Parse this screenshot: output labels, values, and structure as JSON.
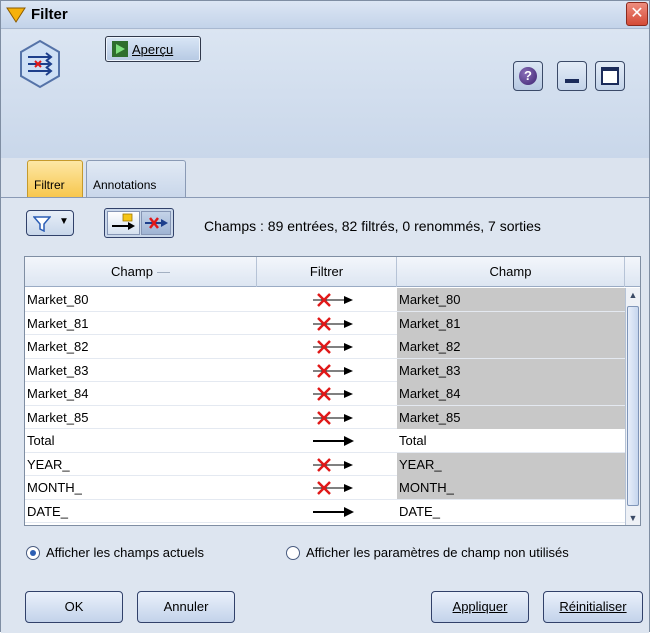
{
  "window": {
    "title": "Filter",
    "close_symbol": "✕"
  },
  "toolbar": {
    "preview_label": "Aperçu",
    "help_symbol": "?"
  },
  "tabs": [
    {
      "label": "Filtrer",
      "active": true
    },
    {
      "label": "Annotations",
      "active": false
    }
  ],
  "filter_bar": {
    "summary": "Champs : 89 entrées, 82 filtrés, 0 renommés, 7 sorties"
  },
  "grid": {
    "headers": [
      "Champ",
      "Filtrer",
      "Champ"
    ],
    "rows": [
      {
        "in": "Market_80",
        "out": "Market_80",
        "filtered": true
      },
      {
        "in": "Market_81",
        "out": "Market_81",
        "filtered": true
      },
      {
        "in": "Market_82",
        "out": "Market_82",
        "filtered": true
      },
      {
        "in": "Market_83",
        "out": "Market_83",
        "filtered": true
      },
      {
        "in": "Market_84",
        "out": "Market_84",
        "filtered": true
      },
      {
        "in": "Market_85",
        "out": "Market_85",
        "filtered": true
      },
      {
        "in": "Total",
        "out": "Total",
        "filtered": false
      },
      {
        "in": "YEAR_",
        "out": "YEAR_",
        "filtered": true
      },
      {
        "in": "MONTH_",
        "out": "MONTH_",
        "filtered": true
      },
      {
        "in": "DATE_",
        "out": "DATE_",
        "filtered": false
      }
    ]
  },
  "options": {
    "show_current": "Afficher les champs actuels",
    "show_unused": "Afficher les paramètres de champ non utilisés",
    "selected": "show_current"
  },
  "buttons": {
    "ok": "OK",
    "cancel": "Annuler",
    "apply": "Appliquer",
    "reset": "Réinitialiser"
  },
  "colors": {
    "filtered_cell": "#c8c8c8",
    "active_tab": "#f7c64b",
    "cross": "#e01818"
  }
}
